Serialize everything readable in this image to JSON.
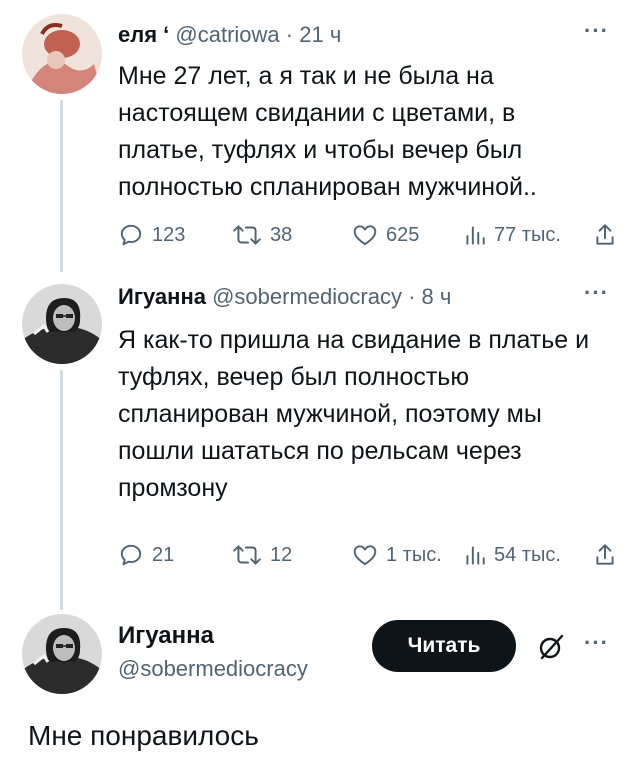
{
  "tweet1": {
    "display_name": "еля ‘",
    "handle": "@catriowa",
    "time": "· 21 ч",
    "more": "···",
    "lines": [
      "Мне 27 лет, а я так и не была на",
      "настоящем свидании с цветами, в",
      "платье, туфлях и чтобы вечер был",
      "полностью спланирован мужчиной.."
    ],
    "stats": {
      "replies": "123",
      "retweets": "38",
      "likes": "625",
      "views": "77 тыс."
    }
  },
  "tweet2": {
    "display_name": "Игуанна",
    "handle": "@sobermediocracy",
    "time": "· 8 ч",
    "more": "···",
    "lines": [
      "Я как-то пришла на свидание в платье и",
      "туфлях, вечер был полностью",
      "спланирован мужчиной, поэтому мы",
      "пошли шататься по рельсам через",
      "промзону"
    ],
    "stats": {
      "replies": "21",
      "retweets": "12",
      "likes": "1 тыс.",
      "views": "54 тыс."
    }
  },
  "profile": {
    "display_name": "Игуанна",
    "handle": "@sobermediocracy",
    "follow_label": "Читать",
    "more": "···"
  },
  "caption": "Мне понравилось",
  "colors": {
    "text": "#0f1419",
    "secondary": "#536471",
    "thread_line": "#cfd9de",
    "button": "#0f1419"
  }
}
